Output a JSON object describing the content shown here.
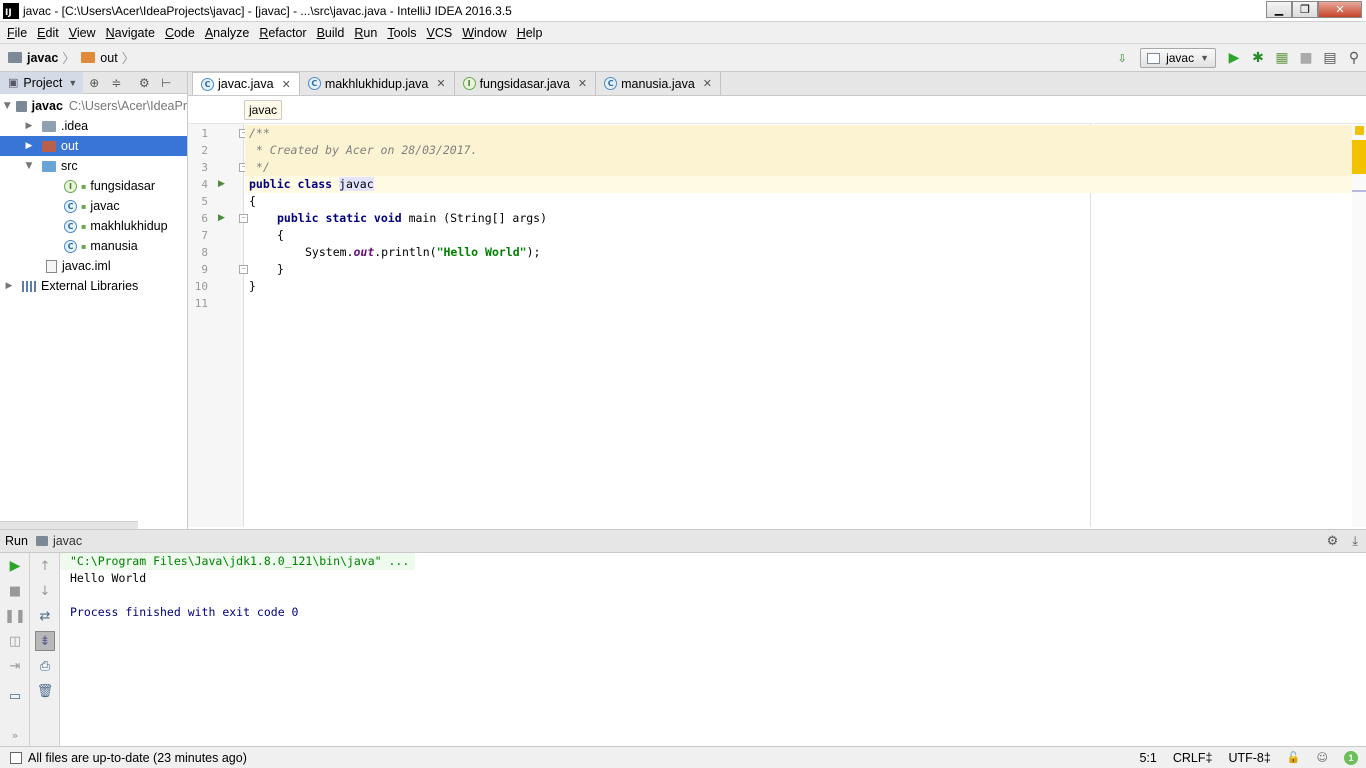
{
  "window": {
    "title": "javac - [C:\\Users\\Acer\\IdeaProjects\\javac] - [javac] - ...\\src\\javac.java - IntelliJ IDEA 2016.3.5",
    "app_icon": "IJ"
  },
  "menu": [
    "File",
    "Edit",
    "View",
    "Navigate",
    "Code",
    "Analyze",
    "Refactor",
    "Build",
    "Run",
    "Tools",
    "VCS",
    "Window",
    "Help"
  ],
  "navbar": {
    "crumbs": [
      "javac",
      "out"
    ],
    "run_config": "javac"
  },
  "project": {
    "tab_label": "Project",
    "tree": [
      {
        "label": "javac",
        "path": "C:\\Users\\Acer\\IdeaPr"
      },
      {
        "label": ".idea"
      },
      {
        "label": "out"
      },
      {
        "label": "src"
      },
      {
        "label": "fungsidasar"
      },
      {
        "label": "javac"
      },
      {
        "label": "makhlukhidup"
      },
      {
        "label": "manusia"
      },
      {
        "label": "javac.iml"
      },
      {
        "label": "External Libraries"
      }
    ]
  },
  "editor": {
    "tabs": [
      "javac.java",
      "makhlukhidup.java",
      "fungsidasar.java",
      "manusia.java"
    ],
    "breadcrumb": "javac",
    "line_numbers": [
      "1",
      "2",
      "3",
      "4",
      "5",
      "6",
      "7",
      "8",
      "9",
      "10",
      "11"
    ],
    "code": {
      "l1": "/**",
      "l2": " * Created by Acer on 28/03/2017.",
      "l3": " */",
      "l4_kw": "public class ",
      "l4_name": "javac",
      "l5": "{",
      "l6_kw": "public static void ",
      "l6_rest": "main (String[] args)",
      "l7": "{",
      "l8_a": "System.",
      "l8_fld": "out",
      "l8_b": ".println(",
      "l8_str": "\"Hello World\"",
      "l8_c": ");",
      "l9": "}",
      "l10": "}"
    }
  },
  "run": {
    "header_label": "Run",
    "tab_name": "javac",
    "console": {
      "cmd": "\"C:\\Program Files\\Java\\jdk1.8.0_121\\bin\\java\" ...",
      "output": "Hello World",
      "process": "Process finished with exit code 0"
    }
  },
  "status": {
    "message": "All files are up-to-date (23 minutes ago)",
    "position": "5:1",
    "line_sep": "CRLF‡",
    "encoding": "UTF-8‡",
    "notifications": "1"
  }
}
